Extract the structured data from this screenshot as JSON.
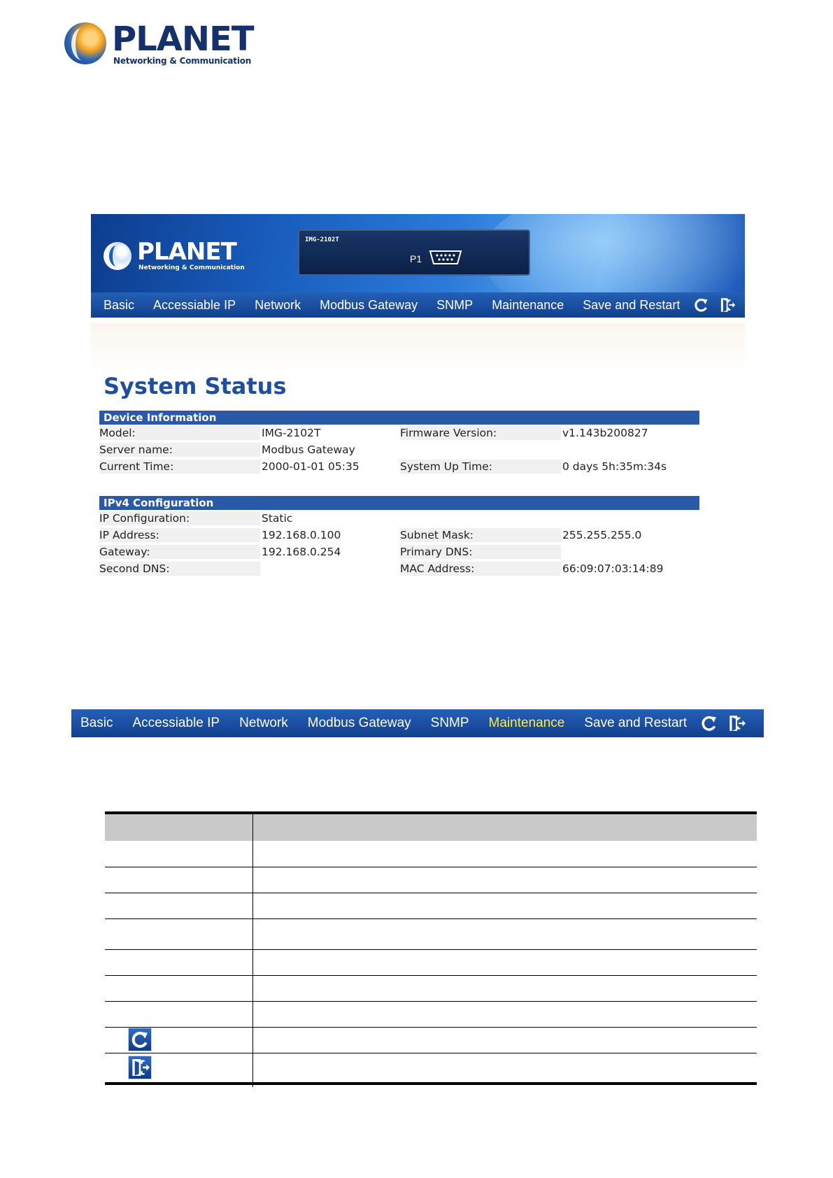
{
  "logo": {
    "wordmark": "PLANET",
    "tagline": "Networking & Communication"
  },
  "banner": {
    "device_model": "IMG-2102T",
    "port_label": "P1"
  },
  "nav_top": {
    "items": [
      "Basic",
      "Accessiable IP",
      "Network",
      "Modbus Gateway",
      "SNMP",
      "Maintenance",
      "Save and Restart"
    ],
    "icons": [
      "refresh-icon",
      "logout-icon"
    ]
  },
  "system_status": {
    "title": "System Status",
    "device_information": {
      "heading": "Device Information",
      "model_label": "Model:",
      "model_value": "IMG-2102T",
      "firmware_label": "Firmware Version:",
      "firmware_value": "v1.143b200827",
      "server_name_label": "Server name:",
      "server_name_value": "Modbus Gateway",
      "current_time_label": "Current Time:",
      "current_time_value": "2000-01-01 05:35",
      "uptime_label": "System Up Time:",
      "uptime_value": "0 days 5h:35m:34s"
    },
    "ipv4": {
      "heading": "IPv4 Configuration",
      "ip_config_label": "IP Configuration:",
      "ip_config_value": "Static",
      "ip_address_label": "IP Address:",
      "ip_address_value": "192.168.0.100",
      "subnet_label": "Subnet Mask:",
      "subnet_value": "255.255.255.0",
      "gateway_label": "Gateway:",
      "gateway_value": "192.168.0.254",
      "primary_dns_label": "Primary DNS:",
      "primary_dns_value": "",
      "second_dns_label": "Second DNS:",
      "second_dns_value": "",
      "mac_label": "MAC Address:",
      "mac_value": "66:09:07:03:14:89"
    }
  },
  "nav_bottom": {
    "items": [
      "Basic",
      "Accessiable IP",
      "Network",
      "Modbus Gateway",
      "SNMP",
      "Maintenance",
      "Save and Restart"
    ],
    "active": "Maintenance",
    "icons": [
      "refresh-icon",
      "logout-icon"
    ]
  },
  "colors": {
    "nav_blue": "#1a4d9e",
    "active_item": "#ffeb3b",
    "section_header": "#2a59a8",
    "title_blue": "#1f4f9c"
  }
}
